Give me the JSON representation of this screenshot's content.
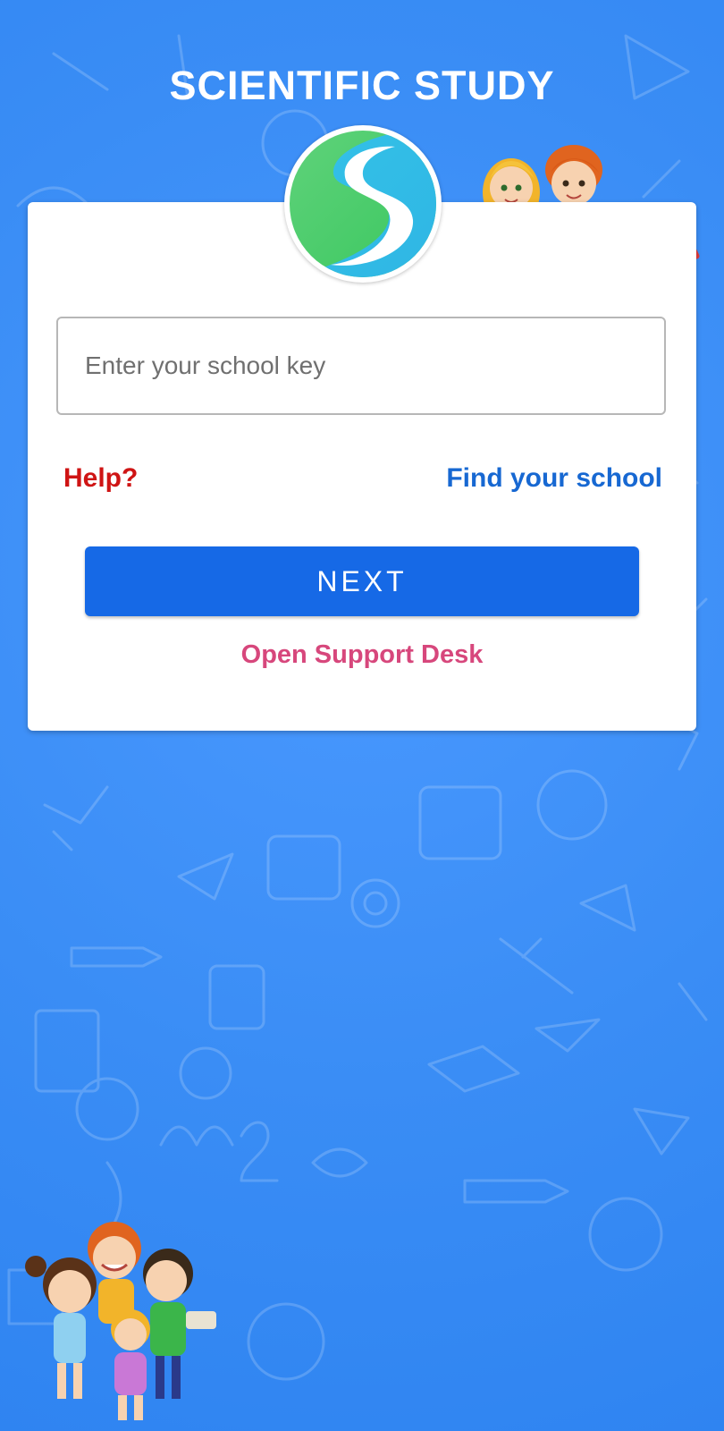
{
  "app": {
    "title": "SCIENTIFIC STUDY",
    "logo": "s-logo"
  },
  "form": {
    "school_key_placeholder": "Enter your school key",
    "school_key_value": ""
  },
  "links": {
    "help": "Help?",
    "find_school": "Find your school",
    "support": "Open Support Desk"
  },
  "buttons": {
    "next": "NEXT"
  },
  "colors": {
    "background": "#3a8df5",
    "primary_button": "#1669e6",
    "help_text": "#cf1414",
    "find_text": "#1768d2",
    "support_text": "#d7477c"
  }
}
